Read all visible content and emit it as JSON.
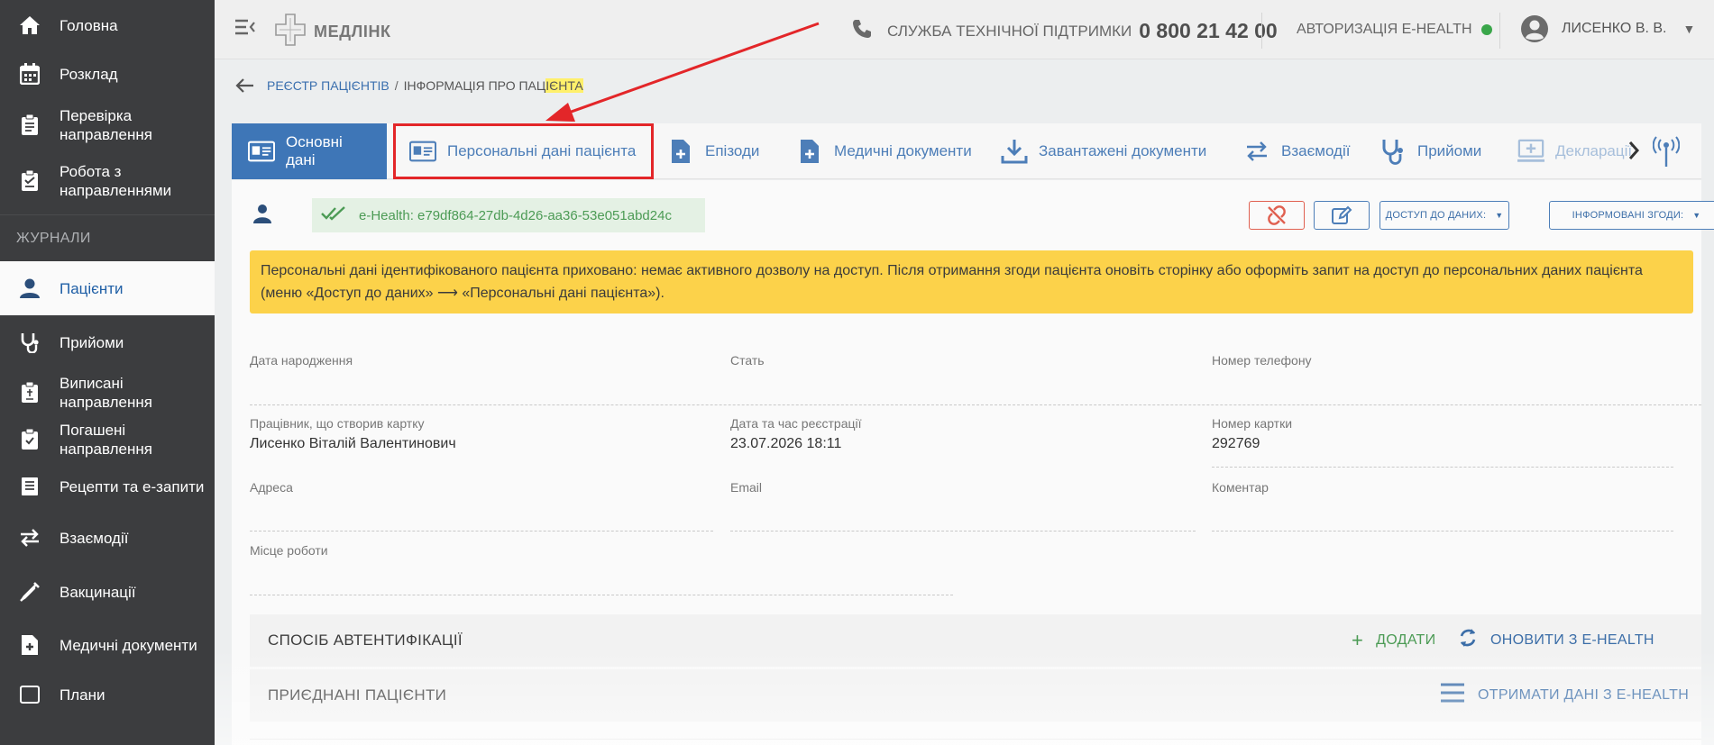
{
  "sidebar": {
    "items": [
      {
        "label": "Головна",
        "icon": "home-icon"
      },
      {
        "label": "Розклад",
        "icon": "calendar-icon"
      },
      {
        "label": "Перевірка направлення",
        "icon": "clipboard-check-icon"
      },
      {
        "label": "Робота з направленнями",
        "icon": "clipboard-list-icon"
      }
    ],
    "section_title": "ЖУРНАЛИ",
    "journal_items": [
      {
        "label": "Пацієнти",
        "icon": "person-icon"
      },
      {
        "label": "Прийоми",
        "icon": "stethoscope-icon"
      },
      {
        "label": "Виписані направлення",
        "icon": "clipboard-issued-icon"
      },
      {
        "label": "Погашені направлення",
        "icon": "clipboard-redeemed-icon"
      },
      {
        "label": "Рецепти та е-запити",
        "icon": "prescription-icon"
      },
      {
        "label": "Взаємодії",
        "icon": "swap-arrows-icon"
      },
      {
        "label": "Вакцинації",
        "icon": "syringe-icon"
      },
      {
        "label": "Медичні документи",
        "icon": "medical-document-icon"
      },
      {
        "label": "Плани",
        "icon": "plans-icon"
      }
    ]
  },
  "topbar": {
    "logo_text": "МЕДЛІНК",
    "support_label": "СЛУЖБА ТЕХНІЧНОЇ ПІДТРИМКИ",
    "support_phone": "0 800 21 42 00",
    "auth_label": "АВТОРИЗАЦІЯ E-HEALTH",
    "auth_status_color": "#3aa64a",
    "user_name": "ЛИСЕНКО В. В."
  },
  "breadcrumb": {
    "parent": "РЕЄСТР ПАЦІЄНТІВ",
    "separator": "/",
    "current_plain": "ІНФОРМАЦІЯ ПРО ПАЦ",
    "current_highlight": "ІЄНТА"
  },
  "tabs": [
    {
      "label": "Основні дані",
      "icon": "id-card-icon",
      "active": true
    },
    {
      "label": "Персональні дані пацієнта",
      "icon": "id-card-icon",
      "active": false
    },
    {
      "label": "Епізоди",
      "icon": "document-plus-icon",
      "active": false
    },
    {
      "label": "Медичні документи",
      "icon": "document-plus-icon",
      "active": false
    },
    {
      "label": "Завантажені документи",
      "icon": "download-icon",
      "active": false
    },
    {
      "label": "Взаємодії",
      "icon": "swap-arrows-icon",
      "active": false
    },
    {
      "label": "Прийоми",
      "icon": "stethoscope-icon",
      "active": false
    },
    {
      "label": "Декларації",
      "icon": "monitor-plus-icon",
      "active": false
    }
  ],
  "ehealth_id": "e-Health: e79df864-27db-4d26-aa36-53e051abd24c",
  "buttons": {
    "data_access": "ДОСТУП ДО ДАНИХ:",
    "consents": "ІНФОРМОВАНІ ЗГОДИ:"
  },
  "warning_text": "Персональні дані ідентифікованого пацієнта приховано: немає активного дозволу на доступ. Після отримання згоди пацієнта оновіть сторінку або оформіть запит на доступ до персональних даних пацієнта (меню «Доступ до даних» ⟶ «Персональні дані пацієнта»).",
  "fields": {
    "birth_date": {
      "label": "Дата народження",
      "value": ""
    },
    "sex": {
      "label": "Стать",
      "value": ""
    },
    "phone": {
      "label": "Номер телефону",
      "value": ""
    },
    "creator": {
      "label": "Працівник, що створив картку",
      "value": "Лисенко Віталій Валентинович"
    },
    "registered": {
      "label": "Дата та час реєстрації",
      "value": "23.07.2026 18:11"
    },
    "card_number": {
      "label": "Номер картки",
      "value": "292769"
    },
    "address": {
      "label": "Адреса",
      "value": ""
    },
    "email": {
      "label": "Email",
      "value": ""
    },
    "comment": {
      "label": "Коментар",
      "value": ""
    },
    "workplace": {
      "label": "Місце роботи",
      "value": ""
    }
  },
  "sections": {
    "auth_method": {
      "title": "СПОСІБ АВТЕНТИФІКАЦІЇ",
      "add": "ДОДАТИ",
      "refresh": "ОНОВИТИ З E-HEALTH"
    },
    "linked_patients": {
      "title": "ПРИЄДНАНІ ПАЦІЄНТИ",
      "fetch": "ОТРИМАТИ ДАНІ З E-HEALTH"
    }
  },
  "colors": {
    "sidebar_bg": "#3c3d3f",
    "accent_blue": "#3e76b7",
    "link_blue": "#4d7eb8",
    "warning_yellow": "#fcd24a",
    "annotation_red": "#e32629",
    "ehealth_green": "#4c9b55"
  }
}
